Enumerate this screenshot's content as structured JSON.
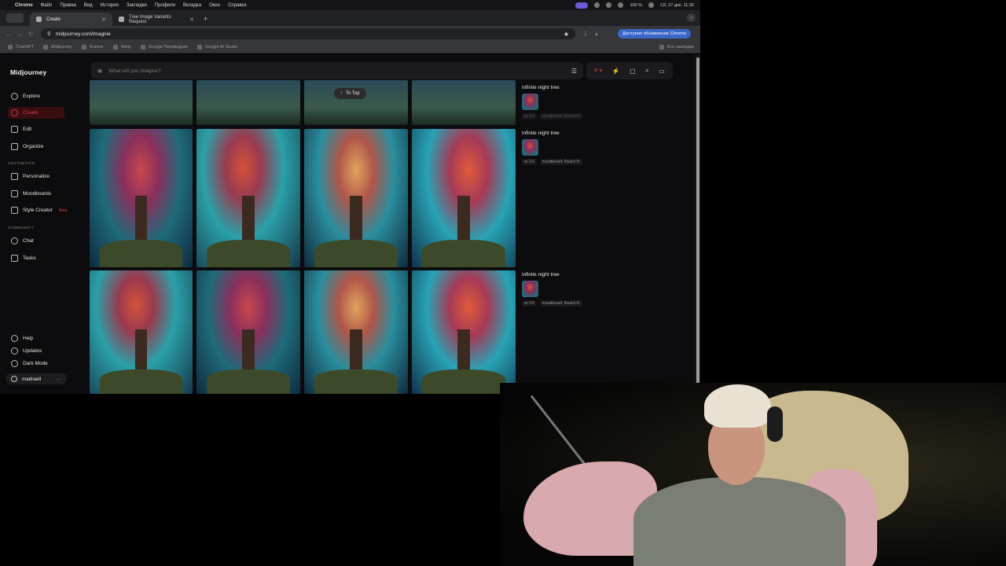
{
  "menubar": {
    "items": [
      "Chrome",
      "Файл",
      "Правка",
      "Вид",
      "История",
      "Закладки",
      "Профили",
      "Вкладка",
      "Окно",
      "Справка"
    ],
    "battery": "100 %",
    "datetime": "Сб, 27 дек. 11:32"
  },
  "tabs": [
    {
      "label": "Create",
      "active": true
    },
    {
      "label": "Tree Image Variants Request",
      "active": false
    }
  ],
  "address": {
    "url": "midjourney.com/imagine",
    "update_button": "Доступно обновление Chrome"
  },
  "bookmarks": {
    "items": [
      "ChatGPT",
      "Midjourney",
      "Runner",
      "Melty",
      "Google Переводчик",
      "Google AI Studio"
    ],
    "all": "Все закладки"
  },
  "sidebar": {
    "logo": "Midjourney",
    "nav": [
      "Explore",
      "Create",
      "Edit",
      "Organize"
    ],
    "aesthetics_label": "AESTHETICS",
    "aesthetics": [
      "Personalize",
      "Moodboards",
      "Style Creator"
    ],
    "beta": "Beta",
    "community_label": "COMMUNITY",
    "community": [
      "Chat",
      "Tasks"
    ],
    "bottom": [
      "Help",
      "Updates",
      "Dark Mode"
    ],
    "username": "madraell"
  },
  "search": {
    "placeholder": "What will you imagine?"
  },
  "to_top": "To Top",
  "prompts": [
    {
      "title": "infinite night tree",
      "ar": "ar 3:4",
      "moodboard": "moodboard: Reach-H"
    },
    {
      "title": "infinite night tree",
      "ar": "ar 3:4",
      "moodboard": "moodboard: Reach-H"
    },
    {
      "title": "infinite night tree",
      "ar": "ar 3:4",
      "moodboard": "moodboard: Reach-H"
    }
  ],
  "colors": {
    "accent": "#e0383e",
    "background": "#0c0c0e"
  }
}
